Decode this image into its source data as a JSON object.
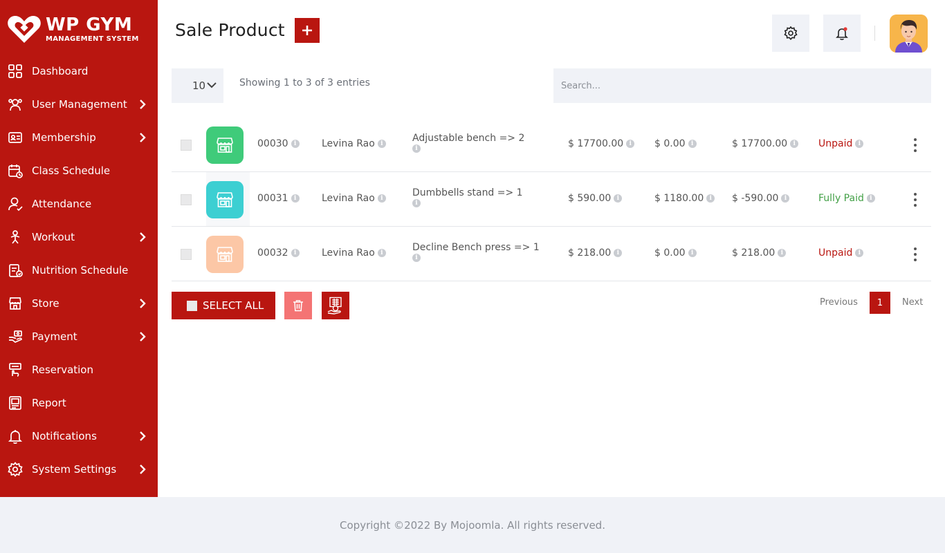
{
  "brand": {
    "title": "WP GYM",
    "subtitle": "MANAGEMENT SYSTEM"
  },
  "sidebar": {
    "items": [
      {
        "label": "Dashboard",
        "icon": "dashboard-icon",
        "has_submenu": false
      },
      {
        "label": "User Management",
        "icon": "users-icon",
        "has_submenu": true
      },
      {
        "label": "Membership",
        "icon": "membership-card-icon",
        "has_submenu": true
      },
      {
        "label": "Class Schedule",
        "icon": "calendar-icon",
        "has_submenu": false
      },
      {
        "label": "Attendance",
        "icon": "attendance-icon",
        "has_submenu": false
      },
      {
        "label": "Workout",
        "icon": "workout-icon",
        "has_submenu": true
      },
      {
        "label": "Nutrition Schedule",
        "icon": "nutrition-icon",
        "has_submenu": false
      },
      {
        "label": "Store",
        "icon": "store-icon",
        "has_submenu": true
      },
      {
        "label": "Payment",
        "icon": "payment-icon",
        "has_submenu": true
      },
      {
        "label": "Reservation",
        "icon": "reservation-icon",
        "has_submenu": false
      },
      {
        "label": "Report",
        "icon": "report-icon",
        "has_submenu": false
      },
      {
        "label": "Notifications",
        "icon": "notification-bell-icon",
        "has_submenu": true
      },
      {
        "label": "System Settings",
        "icon": "settings-gear-icon",
        "has_submenu": true
      }
    ]
  },
  "header": {
    "title": "Sale Product"
  },
  "table_controls": {
    "page_length": "10",
    "info": "Showing 1 to 3 of 3 entries",
    "search_placeholder": "Search..."
  },
  "rows": [
    {
      "id": "00030",
      "member": "Levina Rao",
      "product": "Adjustable bench => 2",
      "amount": "$ 17700.00",
      "paid": "$ 0.00",
      "due": "$ 17700.00",
      "status": "Unpaid",
      "status_type": "unpaid",
      "thumb_color": "#3fcb7a"
    },
    {
      "id": "00031",
      "member": "Levina Rao",
      "product": "Dumbbells stand => 1",
      "amount": "$ 590.00",
      "paid": "$ 1180.00",
      "due": "$ -590.00",
      "status": "Fully Paid",
      "status_type": "paid",
      "thumb_color": "#3ccfd2"
    },
    {
      "id": "00032",
      "member": "Levina Rao",
      "product": "Decline Bench press => 1",
      "amount": "$ 218.00",
      "paid": "$ 0.00",
      "due": "$ 218.00",
      "status": "Unpaid",
      "status_type": "unpaid",
      "thumb_color": "#fcc7a6"
    }
  ],
  "actions": {
    "select_all": "SELECT ALL"
  },
  "pagination": {
    "previous": "Previous",
    "current": "1",
    "next": "Next"
  },
  "footer": {
    "copyright": "Copyright ©2022 By Mojoomla. All rights reserved."
  },
  "colors": {
    "primary": "#b91610",
    "panel_bg": "#f0f2f7",
    "paid": "#43a047",
    "delete": "#f47474"
  }
}
